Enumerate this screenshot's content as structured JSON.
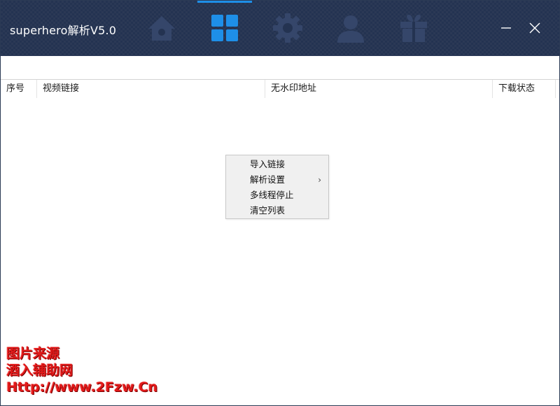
{
  "window": {
    "title": "superhero解析V5.0"
  },
  "nav_tabs": [
    {
      "icon": "home-icon",
      "active": false
    },
    {
      "icon": "grid-icon",
      "active": true
    },
    {
      "icon": "gear-icon",
      "active": false
    },
    {
      "icon": "user-icon",
      "active": false
    },
    {
      "icon": "gift-icon",
      "active": false
    }
  ],
  "window_controls": {
    "minimize": "minimize-icon",
    "close": "close-icon"
  },
  "colors": {
    "titlebar": "#243351",
    "nav_icon": "#35466a",
    "nav_active": "#1e8fe8"
  },
  "table": {
    "columns": [
      "序号",
      "视频链接",
      "无水印地址",
      "下载状态"
    ],
    "rows": []
  },
  "context_menu": {
    "items": [
      {
        "label": "导入链接",
        "has_submenu": false
      },
      {
        "label": "解析设置",
        "has_submenu": true,
        "arrow": "›"
      },
      {
        "label": "多线程停止",
        "has_submenu": false
      },
      {
        "label": "清空列表",
        "has_submenu": false
      }
    ]
  },
  "watermark": {
    "line1": "图片来源",
    "line2": "酒入辅助网",
    "line3": "Http://www.2Fzw.Cn"
  }
}
